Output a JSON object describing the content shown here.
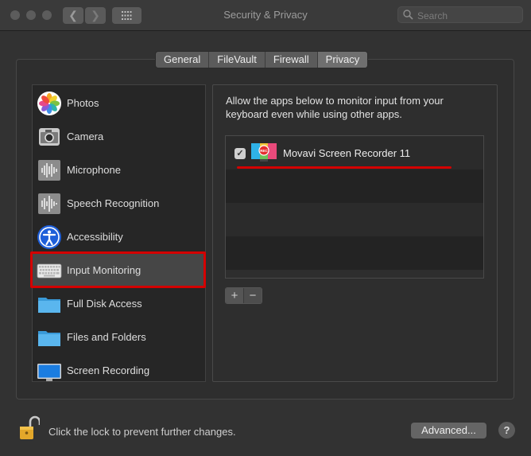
{
  "window": {
    "title": "Security & Privacy",
    "nav_back": "❮",
    "nav_forward": "❯",
    "search_placeholder": "Search"
  },
  "tabs": [
    {
      "label": "General",
      "active": false
    },
    {
      "label": "FileVault",
      "active": false
    },
    {
      "label": "Firewall",
      "active": false
    },
    {
      "label": "Privacy",
      "active": true
    }
  ],
  "sidebar": {
    "items": [
      {
        "label": "Photos",
        "icon": "photos-icon"
      },
      {
        "label": "Camera",
        "icon": "camera-icon"
      },
      {
        "label": "Microphone",
        "icon": "microphone-icon"
      },
      {
        "label": "Speech Recognition",
        "icon": "speech-recognition-icon"
      },
      {
        "label": "Accessibility",
        "icon": "accessibility-icon"
      },
      {
        "label": "Input Monitoring",
        "icon": "keyboard-icon",
        "selected": true
      },
      {
        "label": "Full Disk Access",
        "icon": "folder-icon"
      },
      {
        "label": "Files and Folders",
        "icon": "folder-icon"
      },
      {
        "label": "Screen Recording",
        "icon": "display-icon"
      }
    ]
  },
  "detail": {
    "description": "Allow the apps below to monitor input from your keyboard even while using other apps.",
    "apps": [
      {
        "name": "Movavi Screen Recorder 11",
        "checked": true,
        "icon_text": "REC"
      }
    ],
    "add_label": "+",
    "remove_label": "−"
  },
  "footer": {
    "lock_text": "Click the lock to prevent further changes.",
    "advanced_label": "Advanced...",
    "help_label": "?"
  },
  "colors": {
    "highlight_red": "#d40000",
    "background": "#323232"
  }
}
